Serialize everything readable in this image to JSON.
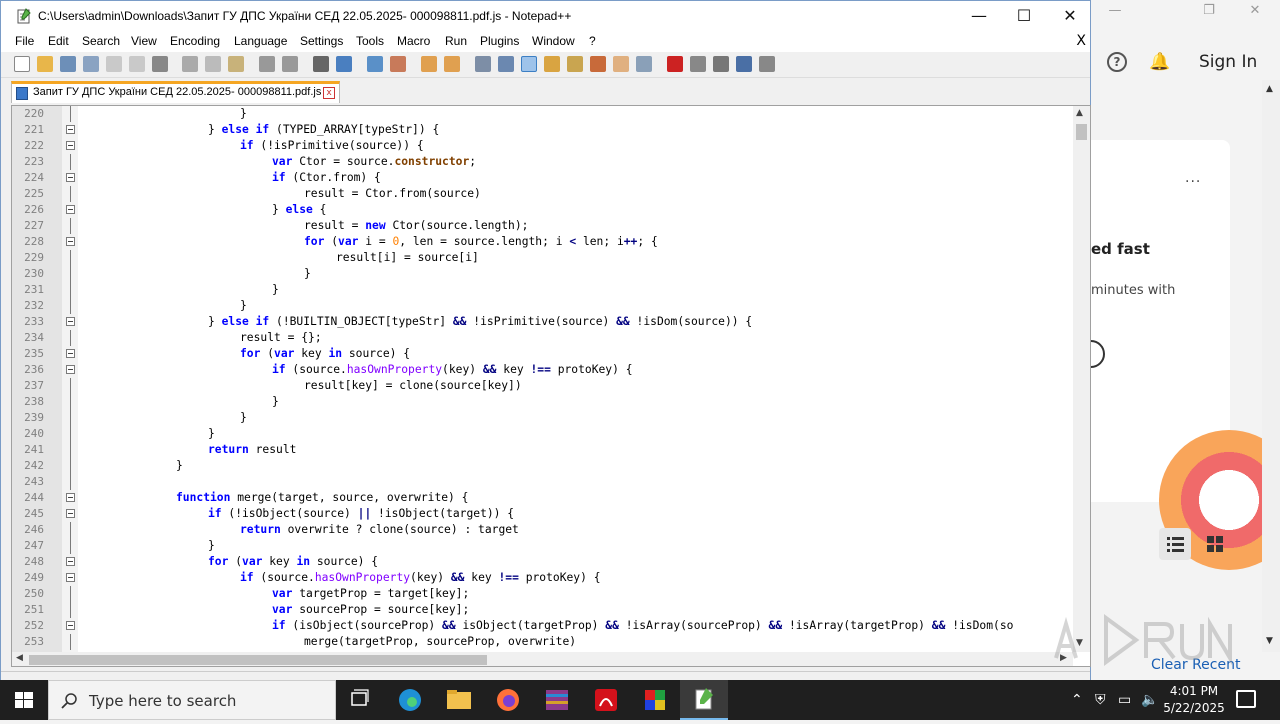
{
  "window": {
    "title": "C:\\Users\\admin\\Downloads\\Запит ГУ ДПС України СЕД 22.05.2025- 000098811.pdf.js - Notepad++",
    "controls": {
      "minimize": "—",
      "maximize": "☐",
      "close": "✕"
    }
  },
  "menu": {
    "items": [
      "File",
      "Edit",
      "Search",
      "View",
      "Encoding",
      "Language",
      "Settings",
      "Tools",
      "Macro",
      "Run",
      "Plugins",
      "Window",
      "?"
    ],
    "close": "X"
  },
  "tab": {
    "label": "Запит ГУ ДПС України СЕД 22.05.2025- 000098811.pdf.js",
    "close": "x"
  },
  "editor": {
    "lines": [
      {
        "n": "220",
        "indent": 5,
        "tokens": [
          [
            "}",
            ""
          ]
        ]
      },
      {
        "n": "221",
        "indent": 4,
        "tokens": [
          [
            "}",
            ""
          ],
          [
            " else if ",
            "kw"
          ],
          [
            "(TYPED_ARRAY[typeStr]) {",
            ""
          ]
        ]
      },
      {
        "n": "222",
        "indent": 5,
        "tokens": [
          [
            "if ",
            "kw"
          ],
          [
            "(!isPrimitive(source)) {",
            ""
          ]
        ]
      },
      {
        "n": "223",
        "indent": 6,
        "tokens": [
          [
            "var ",
            "kw"
          ],
          [
            "Ctor = source.",
            ""
          ],
          [
            "constructor",
            "pr"
          ],
          [
            ";",
            ""
          ]
        ]
      },
      {
        "n": "224",
        "indent": 6,
        "tokens": [
          [
            "if ",
            "kw"
          ],
          [
            "(Ctor.from) {",
            ""
          ]
        ]
      },
      {
        "n": "225",
        "indent": 7,
        "tokens": [
          [
            "result = Ctor.from(source)",
            ""
          ]
        ]
      },
      {
        "n": "226",
        "indent": 6,
        "tokens": [
          [
            "} ",
            ""
          ],
          [
            "else ",
            "kw"
          ],
          [
            "{",
            ""
          ]
        ]
      },
      {
        "n": "227",
        "indent": 7,
        "tokens": [
          [
            "result = ",
            ""
          ],
          [
            "new ",
            "kw"
          ],
          [
            "Ctor(source.length);",
            ""
          ]
        ]
      },
      {
        "n": "228",
        "indent": 7,
        "tokens": [
          [
            "for ",
            "kw"
          ],
          [
            "(",
            ""
          ],
          [
            "var ",
            "kw"
          ],
          [
            "i = ",
            ""
          ],
          [
            "0",
            "nm"
          ],
          [
            ", len = source.length; i ",
            ""
          ],
          [
            "<",
            "op"
          ],
          [
            " len; i",
            ""
          ],
          [
            "++",
            "op"
          ],
          [
            "; {",
            ""
          ]
        ]
      },
      {
        "n": "229",
        "indent": 8,
        "tokens": [
          [
            "result[i] = source[i]",
            ""
          ]
        ]
      },
      {
        "n": "230",
        "indent": 7,
        "tokens": [
          [
            "}",
            ""
          ]
        ]
      },
      {
        "n": "231",
        "indent": 6,
        "tokens": [
          [
            "}",
            ""
          ]
        ]
      },
      {
        "n": "232",
        "indent": 5,
        "tokens": [
          [
            "}",
            ""
          ]
        ]
      },
      {
        "n": "233",
        "indent": 4,
        "tokens": [
          [
            "} ",
            ""
          ],
          [
            "else if ",
            "kw"
          ],
          [
            "(!BUILTIN_OBJECT[typeStr] ",
            ""
          ],
          [
            "&&",
            "op"
          ],
          [
            " !isPrimitive(source) ",
            ""
          ],
          [
            "&&",
            "op"
          ],
          [
            " !isDom(source)) {",
            ""
          ]
        ]
      },
      {
        "n": "234",
        "indent": 5,
        "tokens": [
          [
            "result = {};",
            ""
          ]
        ]
      },
      {
        "n": "235",
        "indent": 5,
        "tokens": [
          [
            "for ",
            "kw"
          ],
          [
            "(",
            ""
          ],
          [
            "var ",
            "kw"
          ],
          [
            "key ",
            ""
          ],
          [
            "in ",
            "kw"
          ],
          [
            "source) {",
            ""
          ]
        ]
      },
      {
        "n": "236",
        "indent": 6,
        "tokens": [
          [
            "if ",
            "kw"
          ],
          [
            "(source.",
            ""
          ],
          [
            "hasOwnProperty",
            "mt"
          ],
          [
            "(key) ",
            ""
          ],
          [
            "&&",
            "op"
          ],
          [
            " key ",
            ""
          ],
          [
            "!==",
            "op"
          ],
          [
            " protoKey) {",
            ""
          ]
        ]
      },
      {
        "n": "237",
        "indent": 7,
        "tokens": [
          [
            "result[key] = clone(source[key])",
            ""
          ]
        ]
      },
      {
        "n": "238",
        "indent": 6,
        "tokens": [
          [
            "}",
            ""
          ]
        ]
      },
      {
        "n": "239",
        "indent": 5,
        "tokens": [
          [
            "}",
            ""
          ]
        ]
      },
      {
        "n": "240",
        "indent": 4,
        "tokens": [
          [
            "}",
            ""
          ]
        ]
      },
      {
        "n": "241",
        "indent": 4,
        "tokens": [
          [
            "return ",
            "kw"
          ],
          [
            "result",
            ""
          ]
        ]
      },
      {
        "n": "242",
        "indent": 3,
        "tokens": [
          [
            "}",
            ""
          ]
        ]
      },
      {
        "n": "243",
        "indent": 0,
        "tokens": []
      },
      {
        "n": "244",
        "indent": 3,
        "tokens": [
          [
            "function ",
            "kw"
          ],
          [
            "merge(target, source, overwrite) {",
            ""
          ]
        ]
      },
      {
        "n": "245",
        "indent": 4,
        "tokens": [
          [
            "if ",
            "kw"
          ],
          [
            "(!isObject(source) ",
            ""
          ],
          [
            "||",
            "op"
          ],
          [
            " !isObject(target)) {",
            ""
          ]
        ]
      },
      {
        "n": "246",
        "indent": 5,
        "tokens": [
          [
            "return ",
            "kw"
          ],
          [
            "overwrite ? clone(source) : target",
            ""
          ]
        ]
      },
      {
        "n": "247",
        "indent": 4,
        "tokens": [
          [
            "}",
            ""
          ]
        ]
      },
      {
        "n": "248",
        "indent": 4,
        "tokens": [
          [
            "for ",
            "kw"
          ],
          [
            "(",
            ""
          ],
          [
            "var ",
            "kw"
          ],
          [
            "key ",
            ""
          ],
          [
            "in ",
            "kw"
          ],
          [
            "source) {",
            ""
          ]
        ]
      },
      {
        "n": "249",
        "indent": 5,
        "tokens": [
          [
            "if ",
            "kw"
          ],
          [
            "(source.",
            ""
          ],
          [
            "hasOwnProperty",
            "mt"
          ],
          [
            "(key) ",
            ""
          ],
          [
            "&&",
            "op"
          ],
          [
            " key ",
            ""
          ],
          [
            "!==",
            "op"
          ],
          [
            " protoKey) {",
            ""
          ]
        ]
      },
      {
        "n": "250",
        "indent": 6,
        "tokens": [
          [
            "var ",
            "kw"
          ],
          [
            "targetProp = target[key];",
            ""
          ]
        ]
      },
      {
        "n": "251",
        "indent": 6,
        "tokens": [
          [
            "var ",
            "kw"
          ],
          [
            "sourceProp = source[key];",
            ""
          ]
        ]
      },
      {
        "n": "252",
        "indent": 6,
        "tokens": [
          [
            "if ",
            "kw"
          ],
          [
            "(isObject(sourceProp) ",
            ""
          ],
          [
            "&&",
            "op"
          ],
          [
            " isObject(targetProp) ",
            ""
          ],
          [
            "&&",
            "op"
          ],
          [
            " !isArray(sourceProp) ",
            ""
          ],
          [
            "&&",
            "op"
          ],
          [
            " !isArray(targetProp) ",
            ""
          ],
          [
            "&&",
            "op"
          ],
          [
            " !isDom(so",
            ""
          ]
        ]
      },
      {
        "n": "253",
        "indent": 7,
        "tokens": [
          [
            "merge(targetProp, sourceProp, overwrite)",
            ""
          ]
        ]
      }
    ],
    "fold_lines": [
      "221",
      "222",
      "224",
      "226",
      "228",
      "233",
      "235",
      "236",
      "244",
      "245",
      "248",
      "249",
      "252"
    ]
  },
  "background_app": {
    "signin": "Sign In",
    "help": "?",
    "card_title": "ed fast",
    "card_subtitle": "minutes with",
    "menu_dots": "...",
    "clear_recent": "Clear Recent"
  },
  "taskbar": {
    "search_placeholder": "Type here to search",
    "time": "4:01 PM",
    "date": "5/22/2025"
  },
  "colors": {
    "keyword": "#0000ff",
    "operator": "#000080",
    "property": "#804000",
    "method": "#8000ff",
    "number": "#ff8000",
    "taskbar": "#1f1f1f",
    "tab_accent": "#f5a623"
  }
}
